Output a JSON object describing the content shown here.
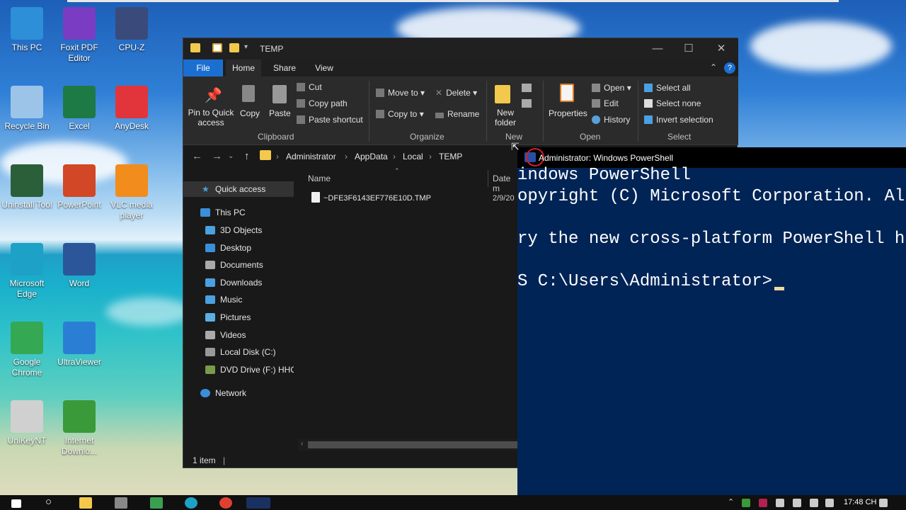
{
  "desktop": {
    "icons": [
      {
        "label": "This PC",
        "color": "#2c8fd8"
      },
      {
        "label": "Foxit PDF Editor",
        "color": "#7a3cc2"
      },
      {
        "label": "CPU-Z",
        "color": "#3a4a7a"
      },
      {
        "label": "Recycle Bin",
        "color": "#9cc4e8"
      },
      {
        "label": "Excel",
        "color": "#1d7a45"
      },
      {
        "label": "AnyDesk",
        "color": "#e2353b"
      },
      {
        "label": "Uninstall Tool",
        "color": "#2b5f3a"
      },
      {
        "label": "PowerPoint",
        "color": "#d24726"
      },
      {
        "label": "VLC media player",
        "color": "#f28c1c"
      },
      {
        "label": "Microsoft Edge",
        "color": "#1da1c6"
      },
      {
        "label": "Word",
        "color": "#2b579a"
      },
      {
        "label": "Google Chrome",
        "color": "#34a853"
      },
      {
        "label": "UltraViewer",
        "color": "#2a7fd4"
      },
      {
        "label": "UniKeyNT",
        "color": "#d0d0d0"
      },
      {
        "label": "Internet Downlo...",
        "color": "#3a9a3a"
      }
    ]
  },
  "explorer": {
    "title": "TEMP",
    "tabs": [
      "File",
      "Home",
      "Share",
      "View"
    ],
    "ribbon": {
      "pin_to_quick_access": "Pin to Quick access",
      "copy": "Copy",
      "paste": "Paste",
      "cut": "Cut",
      "copy_path": "Copy path",
      "paste_shortcut": "Paste shortcut",
      "clipboard_group": "Clipboard",
      "move_to": "Move to",
      "copy_to": "Copy to",
      "delete": "Delete",
      "rename": "Rename",
      "organize_group": "Organize",
      "new_folder": "New folder",
      "new_group": "New",
      "properties": "Properties",
      "open": "Open",
      "edit": "Edit",
      "history": "History",
      "open_group": "Open",
      "select_all": "Select all",
      "select_none": "Select none",
      "invert_selection": "Invert selection",
      "select_group": "Select"
    },
    "breadcrumb": [
      "Administrator",
      "AppData",
      "Local",
      "TEMP"
    ],
    "nav": {
      "quick_access": "Quick access",
      "this_pc": "This PC",
      "items": [
        "3D Objects",
        "Desktop",
        "Documents",
        "Downloads",
        "Music",
        "Pictures",
        "Videos",
        "Local Disk (C:)",
        "DVD Drive (F:) HHO"
      ],
      "network": "Network"
    },
    "columns": {
      "name": "Name",
      "date": "Date m"
    },
    "files": [
      {
        "name": "~DFE3F6143EF776E10D.TMP",
        "date": "2/9/20"
      }
    ],
    "status": "1 item"
  },
  "powershell": {
    "title": "Administrator: Windows PowerShell",
    "lines": [
      "indows PowerShell",
      "opyright (C) Microsoft Corporation. All",
      "",
      "ry the new cross-platform PowerShell htt",
      "",
      "S C:\\Users\\Administrator> "
    ]
  },
  "taskbar": {
    "time": "17:48 CH"
  }
}
